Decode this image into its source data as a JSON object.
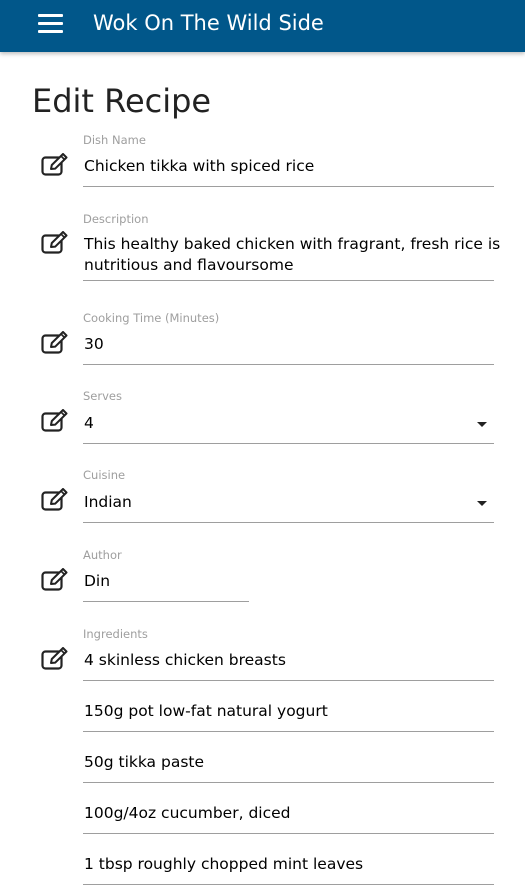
{
  "header": {
    "title": "Wok On The Wild Side"
  },
  "page": {
    "title": "Edit Recipe"
  },
  "fields": {
    "dish_name": {
      "label": "Dish Name",
      "value": "Chicken tikka with spiced rice"
    },
    "description": {
      "label": "Description",
      "line1": "This healthy baked chicken with fragrant, fresh rice is",
      "line2": "nutritious and flavoursome"
    },
    "cooking_time": {
      "label": "Cooking Time (Minutes)",
      "value": "30"
    },
    "serves": {
      "label": "Serves",
      "value": "4"
    },
    "cuisine": {
      "label": "Cuisine",
      "value": "Indian"
    },
    "author": {
      "label": "Author",
      "value": "Din"
    },
    "ingredients": {
      "label": "Ingredients",
      "items": [
        "4 skinless chicken breasts",
        "150g pot low-fat natural yogurt",
        "50g tikka paste",
        "100g/4oz cucumber, diced",
        "1 tbsp roughly chopped mint leaves"
      ]
    }
  },
  "icons": {
    "menu": "hamburger-menu-icon",
    "edit": "pencil-square-icon"
  },
  "colors": {
    "navbar": "#01578a",
    "label": "#9e9e9e",
    "underline": "#9e9e9e"
  }
}
